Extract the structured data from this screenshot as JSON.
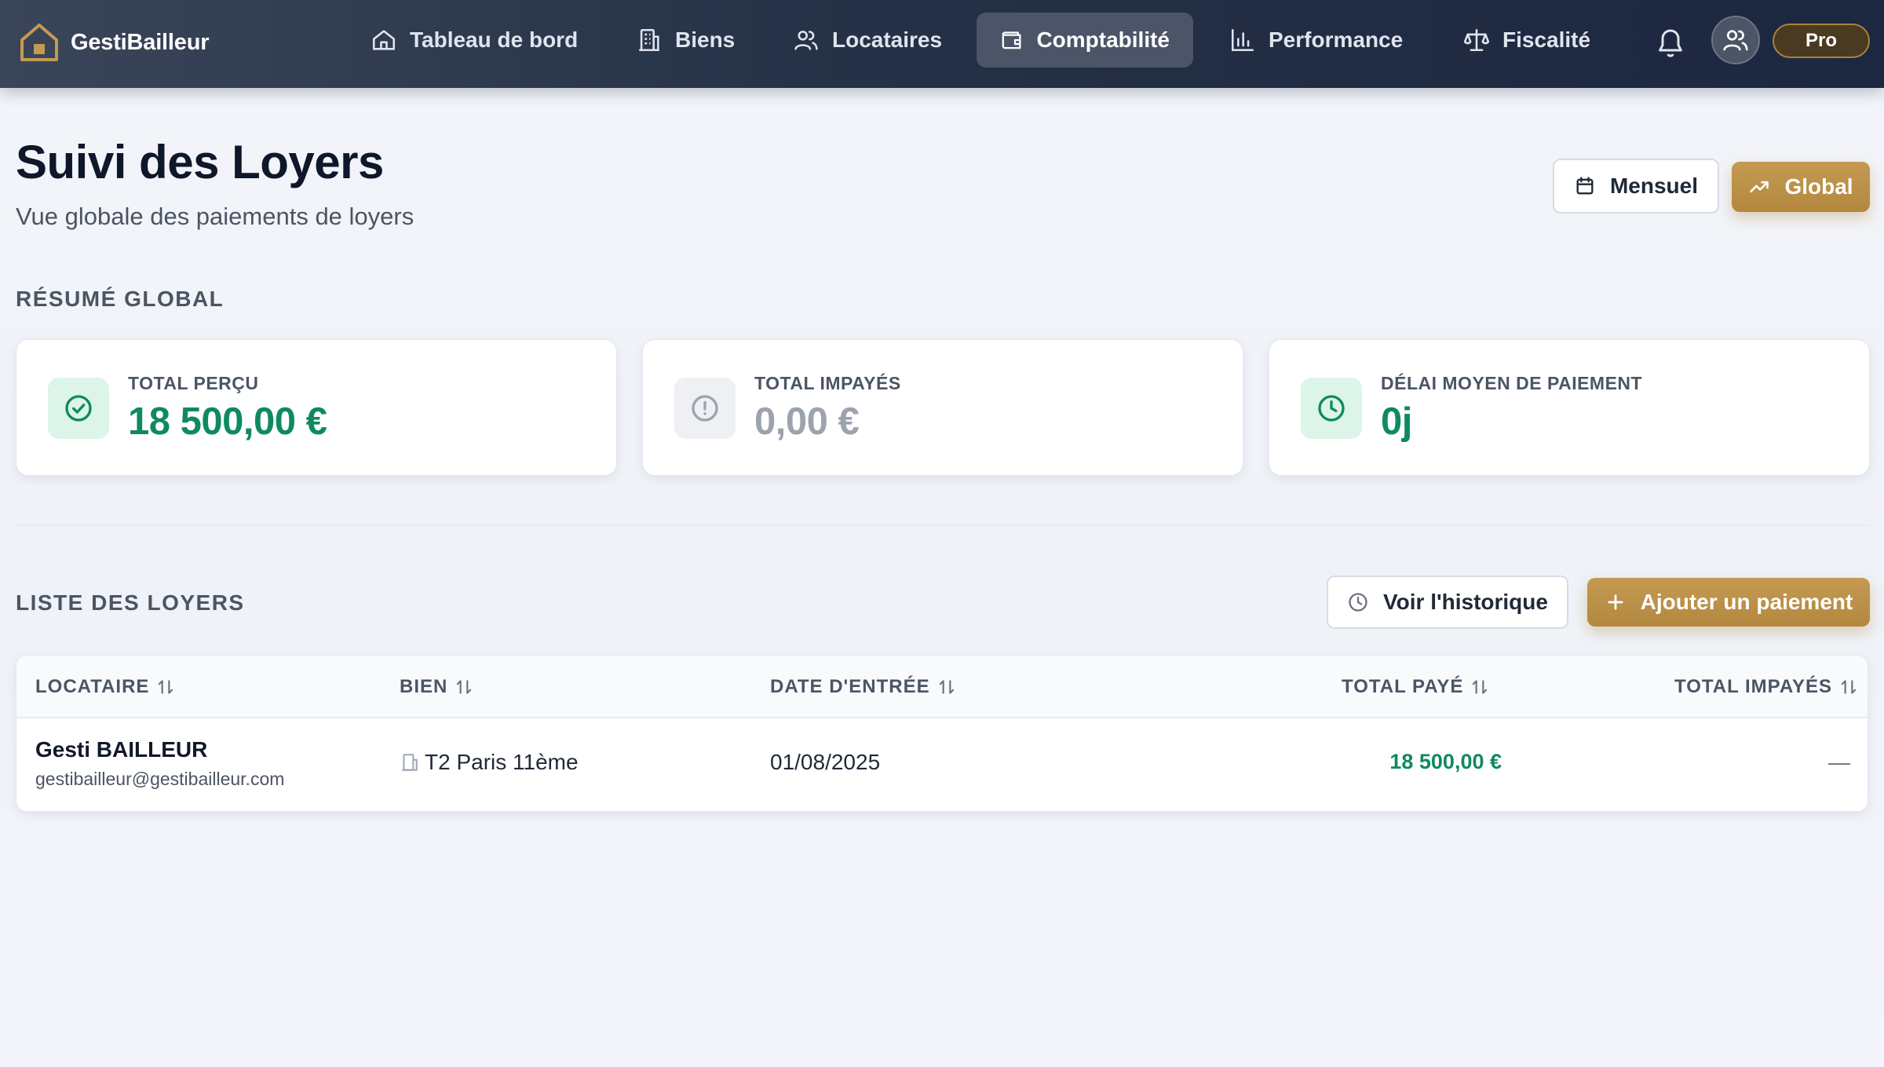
{
  "nav": {
    "brand": "GestiBailleur",
    "items": [
      {
        "label": "Tableau de bord",
        "icon": "home-icon"
      },
      {
        "label": "Biens",
        "icon": "building-icon"
      },
      {
        "label": "Locataires",
        "icon": "users-icon"
      },
      {
        "label": "Comptabilité",
        "icon": "wallet-icon",
        "active": true
      },
      {
        "label": "Performance",
        "icon": "bar-chart-icon"
      },
      {
        "label": "Fiscalité",
        "icon": "scales-icon"
      }
    ],
    "badge": "Pro"
  },
  "header": {
    "title": "Suivi des Loyers",
    "subtitle": "Vue globale des paiements de loyers",
    "view_buttons": {
      "monthly": "Mensuel",
      "global": "Global"
    }
  },
  "summary": {
    "section_title": "RÉSUMÉ GLOBAL",
    "cards": [
      {
        "label": "TOTAL PERÇU",
        "value": "18 500,00 €",
        "icon": "check-circle-icon",
        "color": "#0f8a5f"
      },
      {
        "label": "TOTAL IMPAYÉS",
        "value": "0,00 €",
        "icon": "alert-circle-icon",
        "color": "#9ca3af"
      },
      {
        "label": "DÉLAI MOYEN DE PAIEMENT",
        "value": "0j",
        "icon": "clock-icon",
        "color": "#0f8a5f"
      }
    ]
  },
  "rents": {
    "section_title": "LISTE DES LOYERS",
    "history_button": "Voir l'historique",
    "add_button": "Ajouter un paiement",
    "columns": [
      "LOCATAIRE",
      "BIEN",
      "DATE D'ENTRÉE",
      "TOTAL PAYÉ",
      "TOTAL IMPAYÉS"
    ],
    "rows": [
      {
        "tenant_name": "Gesti BAILLEUR",
        "tenant_email": "gestibailleur@gestibailleur.com",
        "property": "T2 Paris 11ème",
        "entry_date": "01/08/2025",
        "total_paid": "18 500,00 €",
        "total_unpaid": "—"
      }
    ]
  },
  "colors": {
    "accent_gold": "#b3873e",
    "success_green": "#0f8a5f",
    "nav_dark": "#1f2a3f"
  }
}
